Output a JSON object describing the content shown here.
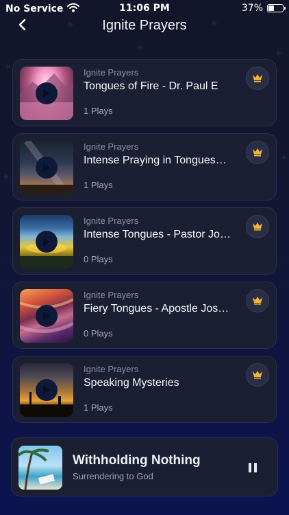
{
  "status_bar": {
    "carrier": "No Service",
    "time": "11:06 PM",
    "battery_percent": "37%",
    "battery_level": 0.37
  },
  "nav": {
    "title": "Ignite Prayers",
    "back_icon": "chevron-left-icon"
  },
  "tracks": [
    {
      "source": "Ignite Prayers",
      "title": "Tongues of Fire - Dr. Paul E",
      "plays": "1 Plays",
      "premium_icon": "crown-icon"
    },
    {
      "source": "Ignite Prayers",
      "title": "Intense Praying in Tongues…",
      "plays": "1 Plays",
      "premium_icon": "crown-icon"
    },
    {
      "source": "Ignite Prayers",
      "title": "Intense Tongues - Pastor Jo…",
      "plays": "0 Plays",
      "premium_icon": "crown-icon"
    },
    {
      "source": "Ignite Prayers",
      "title": "Fiery Tongues - Apostle Jos…",
      "plays": "0 Plays",
      "premium_icon": "crown-icon"
    },
    {
      "source": "Ignite Prayers",
      "title": "Speaking Mysteries",
      "plays": "1 Plays",
      "premium_icon": "crown-icon"
    }
  ],
  "mini_player": {
    "title": "Withholding Nothing",
    "subtitle": "Surrendering to God",
    "control_icon": "pause-icon"
  },
  "colors": {
    "accent_gold": "#f2b53a",
    "card_background": "#1b1f33",
    "page_background": "#121634"
  }
}
